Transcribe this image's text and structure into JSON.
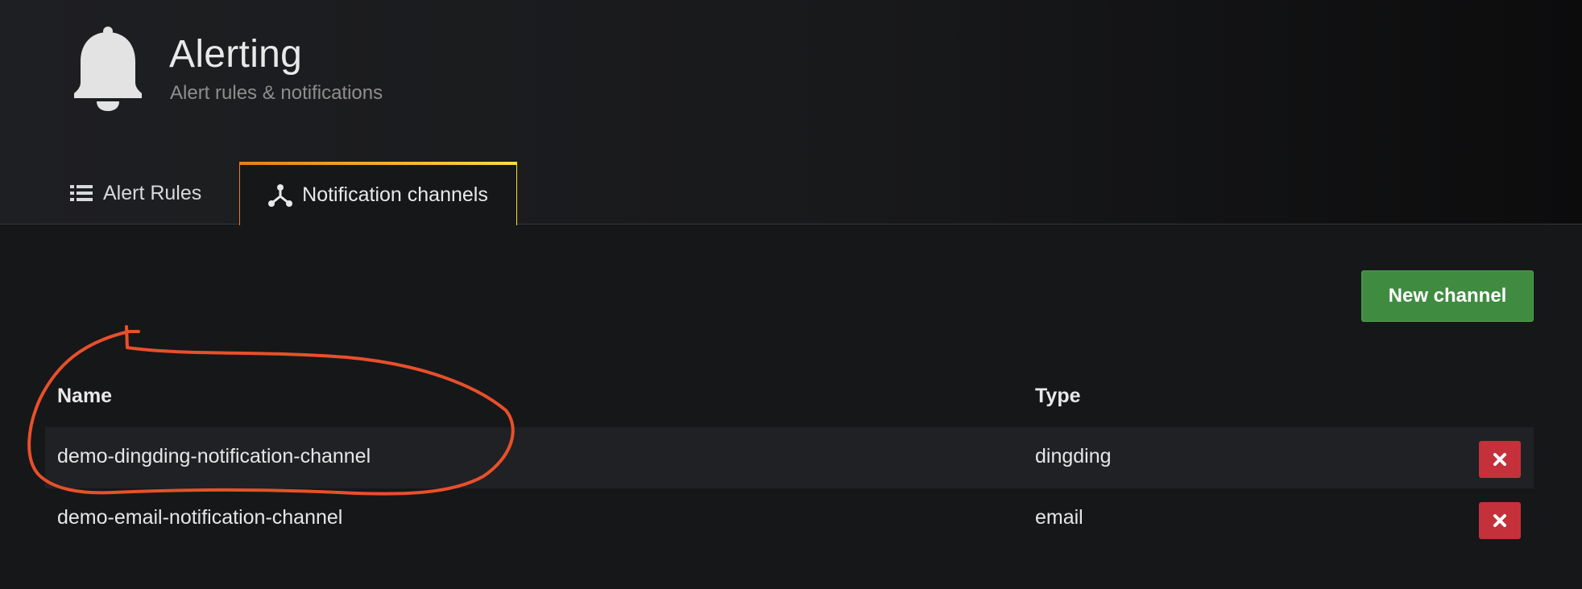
{
  "header": {
    "title": "Alerting",
    "subtitle": "Alert rules & notifications",
    "icon": "bell-icon"
  },
  "tabs": [
    {
      "label": "Alert Rules",
      "icon": "list-icon",
      "active": false
    },
    {
      "label": "Notification channels",
      "icon": "share-nodes-icon",
      "active": true
    }
  ],
  "toolbar": {
    "new_channel_label": "New channel"
  },
  "table": {
    "columns": [
      "Name",
      "Type"
    ],
    "rows": [
      {
        "name": "demo-dingding-notification-channel",
        "type": "dingding"
      },
      {
        "name": "demo-email-notification-channel",
        "type": "email"
      }
    ]
  },
  "colors": {
    "accent_gradient_start": "#eb7b18",
    "accent_gradient_end": "#fadd43",
    "primary_button": "#3f8c41",
    "danger_button": "#c4313b",
    "annotation_stroke": "#e8502a"
  }
}
